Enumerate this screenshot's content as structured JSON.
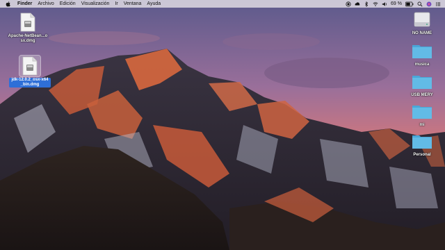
{
  "menubar": {
    "app_name": "Finder",
    "menus": [
      "Archivo",
      "Edición",
      "Visualización",
      "Ir",
      "Ventana",
      "Ayuda"
    ],
    "battery_text": "69 %",
    "icons": [
      "apple-icon",
      "record-icon",
      "creative-cloud-icon",
      "bluetooth-icon",
      "wifi-icon",
      "volume-icon",
      "battery-icon",
      "search-icon",
      "siri-icon",
      "notifications-icon"
    ]
  },
  "desktop": {
    "left_icons": [
      {
        "label": "Apache-NetBean...osx.dmg",
        "type": "dmg",
        "selected": false
      },
      {
        "label": "jdk-12.0.2_osx-x64_bin.dmg",
        "type": "dmg",
        "selected": true
      }
    ],
    "right_icons": [
      {
        "label": "NO NAME",
        "type": "drive"
      },
      {
        "label": "musica",
        "type": "folder"
      },
      {
        "label": "USB MERY",
        "type": "folder"
      },
      {
        "label": "mi",
        "type": "folder"
      },
      {
        "label": "Personal",
        "type": "folder"
      }
    ]
  },
  "colors": {
    "folder": "#5ab4e0",
    "selection": "#2e6fd8",
    "sky_top": "#6a6a9a",
    "sky_horizon": "#e07a70"
  }
}
